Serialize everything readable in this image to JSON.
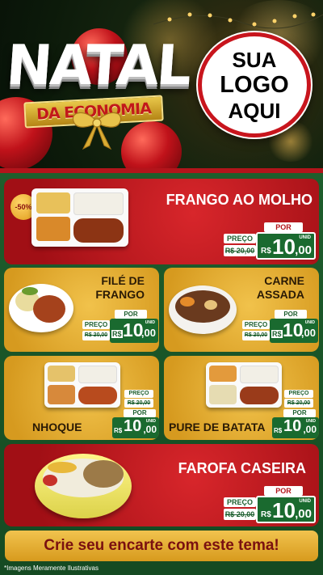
{
  "header": {
    "title_main": "NATAL",
    "title_sub": "DA ECONOMIA",
    "logo_lines": [
      "SUA",
      "LOGO",
      "AQUI"
    ]
  },
  "colors": {
    "red": "#b3141b",
    "gold": "#e1a92c",
    "green": "#1a6a2f"
  },
  "products": [
    {
      "name": "FRANGO AO MOLHO",
      "badge": "-50%",
      "price_label": "PREÇO",
      "old_price": "R$ 20,00",
      "por": "POR",
      "currency": "R$",
      "price_int": "10",
      "price_dec": ",00",
      "unit": "UNID"
    },
    {
      "name_l1": "FILÉ DE",
      "name_l2": "FRANGO",
      "price_label": "PREÇO",
      "old_price": "R$ 20,00",
      "por": "POR",
      "currency": "R$",
      "price_int": "10",
      "price_dec": ",00",
      "unit": "UNID"
    },
    {
      "name_l1": "CARNE",
      "name_l2": "ASSADA",
      "price_label": "PREÇO",
      "old_price": "R$ 20,00",
      "por": "POR",
      "currency": "R$",
      "price_int": "10",
      "price_dec": ",00",
      "unit": "UNID"
    },
    {
      "name": "NHOQUE",
      "price_label": "PREÇO",
      "old_price": "R$ 20,00",
      "por": "POR",
      "currency": "R$",
      "price_int": "10",
      "price_dec": ",00",
      "unit": "UNID"
    },
    {
      "name": "PURE DE BATATA",
      "price_label": "PREÇO",
      "old_price": "R$ 20,00",
      "por": "POR",
      "currency": "R$",
      "price_int": "10",
      "price_dec": ",00",
      "unit": "UNID"
    },
    {
      "name": "FAROFA CASEIRA",
      "price_label": "PREÇO",
      "old_price": "R$ 20,00",
      "por": "POR",
      "currency": "R$",
      "price_int": "10",
      "price_dec": ",00",
      "unit": "UNID"
    }
  ],
  "banner": "Crie seu encarte com este tema!",
  "footnote": "*Imagens Meramente Ilustrativas"
}
